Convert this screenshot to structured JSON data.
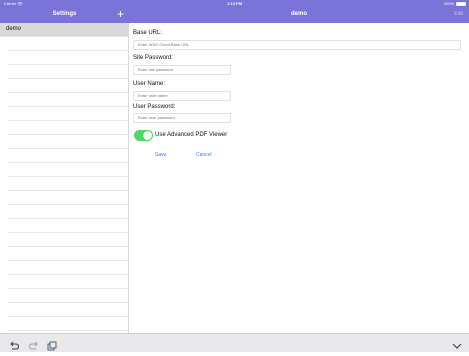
{
  "status": {
    "carrier": "Carrier",
    "time": "1:13 PM",
    "battery_text": "100%",
    "battery_level": 1.0
  },
  "nav": {
    "left_title": "Settings",
    "right_title": "demo",
    "edit_label": "Edit",
    "plus_symbol": "+"
  },
  "sidebar": {
    "items": [
      {
        "label": "demo"
      }
    ]
  },
  "form": {
    "base_url_label": "Base URL:",
    "base_url_placeholder": "Enter WSO Cloud Base URL",
    "site_password_label": "Site Password:",
    "site_password_placeholder": "Enter site password",
    "user_name_label": "User Name:",
    "user_name_placeholder": "Enter user name",
    "user_password_label": "User Password:",
    "user_password_placeholder": "Enter user password",
    "advanced_pdf_label": "Use Advanced PDF Viewer",
    "advanced_pdf_enabled": true,
    "save_label": "Save",
    "cancel_label": "Cancel"
  },
  "colors": {
    "header": "#7b74d8",
    "toggle_on": "#4cd964",
    "link": "#3478f6"
  },
  "toolbar": {
    "icons": [
      "undo-icon",
      "redo-icon",
      "clipboard-icon",
      "chevron-down-icon"
    ]
  }
}
